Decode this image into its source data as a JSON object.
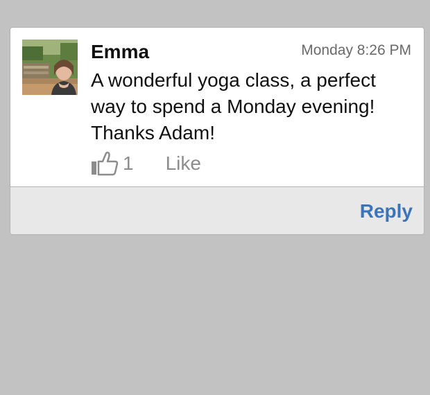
{
  "comment": {
    "author": "Emma",
    "timestamp": "Monday 8:26 PM",
    "message": "A wonderful yoga class, a perfect way to spend a Monday evening! Thanks Adam!",
    "like_count": "1",
    "like_label": "Like",
    "icons": {
      "avatar": "user-photo",
      "like": "thumbs-up-icon"
    }
  },
  "footer": {
    "reply_label": "Reply"
  },
  "colors": {
    "background": "#c2c2c2",
    "card": "#ffffff",
    "footer": "#e8e8e8",
    "reply_link": "#3b74ba",
    "muted_text": "#8c8c8c"
  }
}
